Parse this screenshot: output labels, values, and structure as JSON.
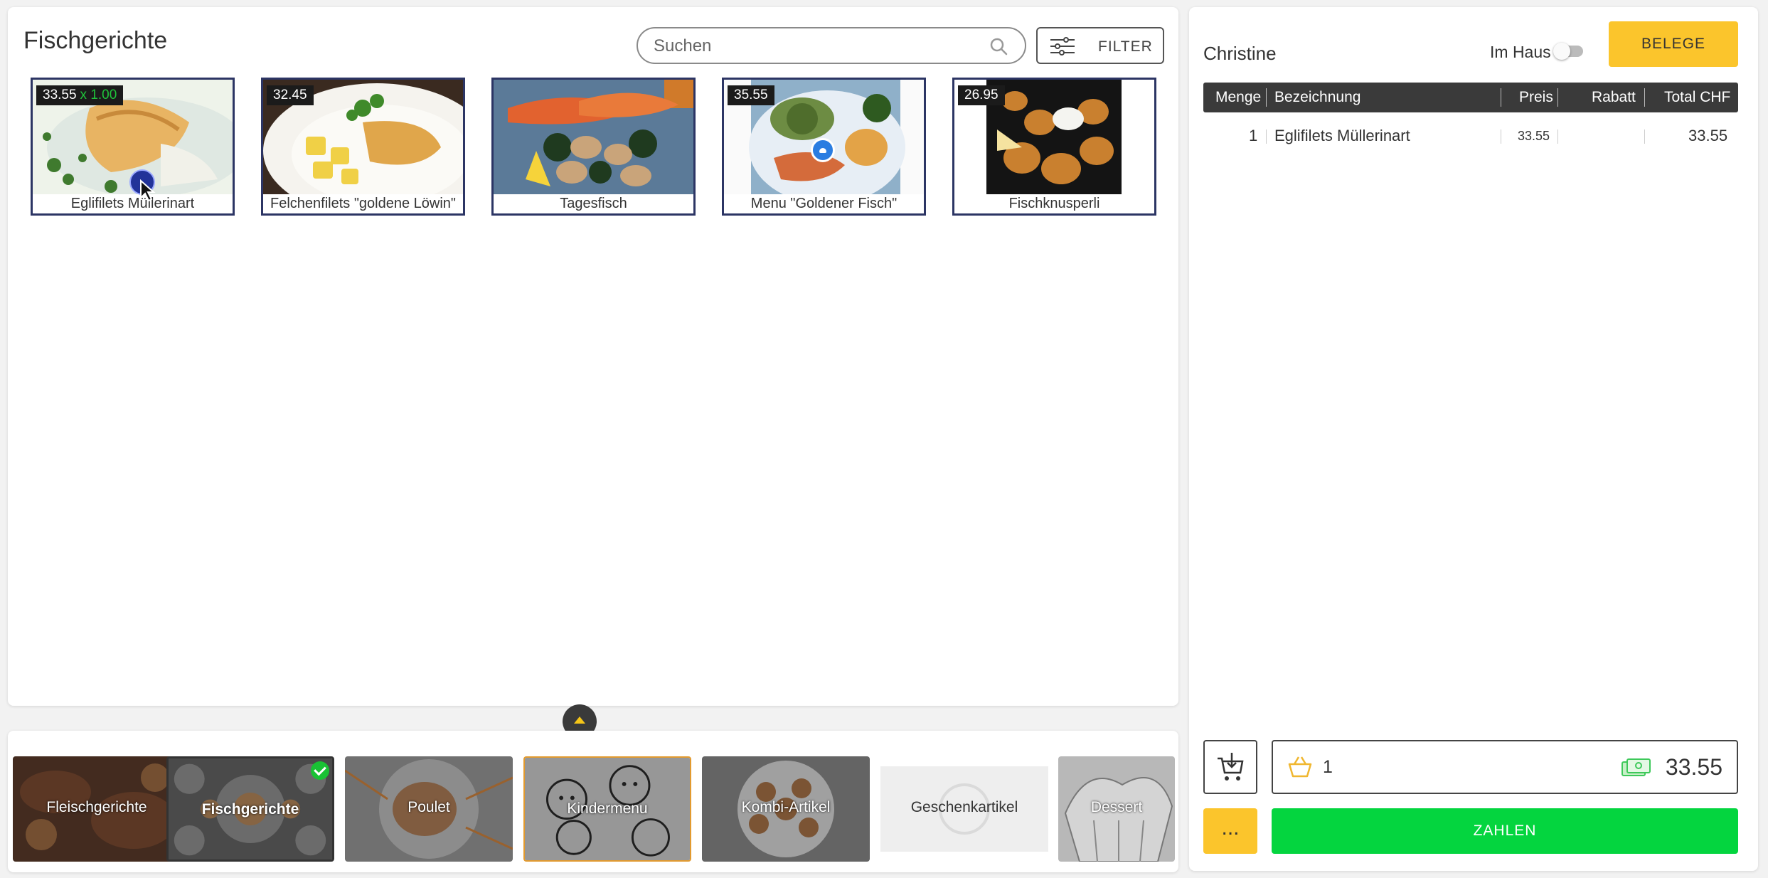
{
  "main": {
    "title": "Fischgerichte",
    "search_placeholder": "Suchen",
    "filter_label": "FILTER"
  },
  "products": [
    {
      "name": "Eglifilets Müllerinart",
      "price": "33.55",
      "qty": "x 1.00",
      "selected": true
    },
    {
      "name": "Felchenfilets \"goldene Löwin\"",
      "price": "32.45"
    },
    {
      "name": "Tagesfisch",
      "price": ""
    },
    {
      "name": "Menu \"Goldener Fisch\"",
      "price": "35.55",
      "has_info": true
    },
    {
      "name": "Fischknusperli",
      "price": "26.95"
    }
  ],
  "categories": [
    {
      "label": "Fleischgerichte"
    },
    {
      "label": "Fischgerichte",
      "active": true
    },
    {
      "label": "Poulet"
    },
    {
      "label": "Kindermenu"
    },
    {
      "label": "Kombi-Artikel"
    },
    {
      "label": "Geschenkartikel"
    },
    {
      "label": "Dessert"
    }
  ],
  "order": {
    "customer": "Christine",
    "in_house_label": "Im Haus",
    "in_house_on": false,
    "belege_label": "BELEGE",
    "columns": {
      "menge": "Menge",
      "bezeichnung": "Bezeichnung",
      "preis": "Preis",
      "rabatt": "Rabatt",
      "total": "Total CHF"
    },
    "rows": [
      {
        "menge": "1",
        "bezeichnung": "Eglifilets Müllerinart",
        "preis": "33.55",
        "rabatt": "",
        "total": "33.55"
      }
    ],
    "item_count": "1",
    "total": "33.55",
    "more_label": "...",
    "pay_label": "ZAHLEN"
  },
  "colors": {
    "accent_yellow": "#fbc52c",
    "pay_green": "#04d53f",
    "header_dark": "#3a3a3a",
    "frame_navy": "#2c3564"
  },
  "icons": [
    "search-icon",
    "filter-sliders-icon",
    "cart-download-icon",
    "basket-icon",
    "money-icon",
    "chevron-up-icon",
    "check-icon",
    "info-icon"
  ]
}
